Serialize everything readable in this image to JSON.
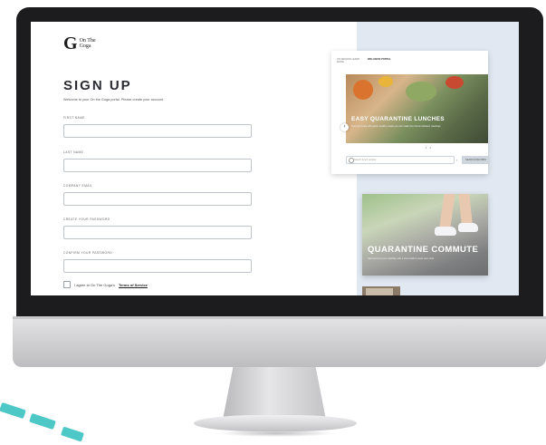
{
  "brand": {
    "logo_letter": "G",
    "logo_text": "On The Goga"
  },
  "form": {
    "title": "SIGN UP",
    "subtitle": "Welcome to your On the Goga portal. Please create your account.",
    "fields": [
      {
        "label": "FIRST NAME",
        "value": ""
      },
      {
        "label": "LAST NAME",
        "value": ""
      },
      {
        "label": "COMPANY EMAIL",
        "value": ""
      },
      {
        "label": "CREATE YOUR PASSWORD",
        "value": ""
      },
      {
        "label": "CONFIRM YOUR PASSWORD",
        "value": ""
      }
    ],
    "agree_text": "I agree to On The Goga's",
    "tos_link": "Terms of Service"
  },
  "preview": {
    "tabs": [
      {
        "label": "ON DEMAND LEARN MORE"
      },
      {
        "label": "WELLNESS PORTAL",
        "active": true
      }
    ],
    "feature_title": "EASY QUARANTINE LUNCHES",
    "feature_subtitle": "Fuel your body with quick, healthy meals you can make from home between meetings.",
    "search_placeholder": "Search lunch recipes",
    "search_button": "SEARCH RECIPES",
    "carousel_dots": "• •",
    "arrow_icon": "chevron-left-icon",
    "commute_title": "QUARANTINE COMMUTE",
    "commute_subtitle": "Start and end your workday with a short walk to reset your mind."
  },
  "colors": {
    "accent_dashes": "#4ec7c7",
    "bezel": "#1c1c1e",
    "panel_bg": "#e2e8f1"
  }
}
